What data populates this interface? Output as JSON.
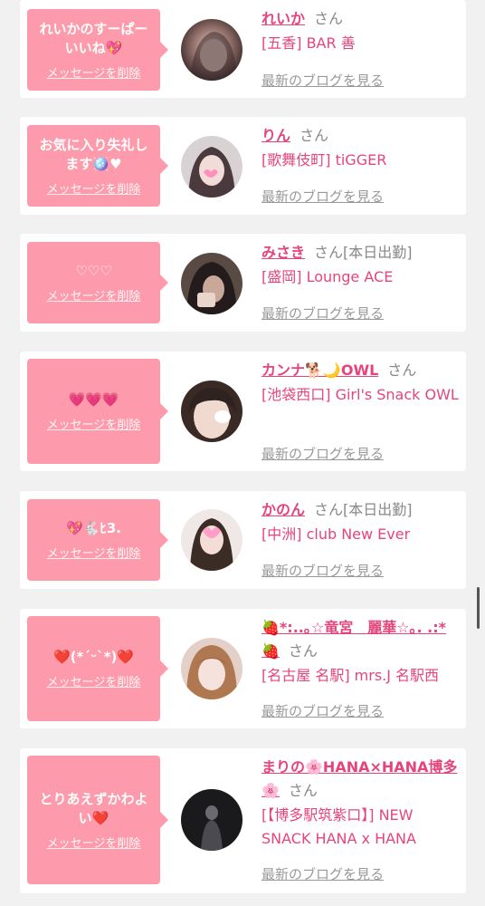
{
  "cards": [
    {
      "message": "れいかのすーぱー\nいいね💖",
      "delete_label": "メッセージを削除",
      "name": "れいか",
      "san": "さん",
      "status": "",
      "shop": "[五香] BAR 善",
      "blog_label": "最新のブログを見る"
    },
    {
      "message": "お気に入り失礼し\nます🪩♥",
      "delete_label": "メッセージを削除",
      "name": "りん",
      "san": "さん",
      "status": "",
      "shop": "[歌舞伎町] tiGGER",
      "blog_label": "最新のブログを見る"
    },
    {
      "message": "♡♡♡",
      "delete_label": "メッセージを削除",
      "name": "みさき",
      "san": "さん",
      "status": "[本日出勤]",
      "shop": "[盛岡] Lounge ACE",
      "blog_label": "最新のブログを見る"
    },
    {
      "message": "💗💗💗",
      "delete_label": "メッセージを削除",
      "name": "カンナ🐕🌙OWL",
      "san": "さん",
      "status": "",
      "shop": "[池袋西口] Girl's Snack OWL",
      "blog_label": "最新のブログを見る"
    },
    {
      "message": "💖🐇ﾋ3.",
      "delete_label": "メッセージを削除",
      "name": "かのん",
      "san": "さん",
      "status": "[本日出勤]",
      "shop": "[中洲] club New Ever",
      "blog_label": "最新のブログを見る"
    },
    {
      "message": "❤️(*´ᵕ`*)❤️",
      "delete_label": "メッセージを削除",
      "name": "🍓*:..｡☆竜宮　麗華☆｡. .:*🍓",
      "san": "さん",
      "status": "",
      "shop": "[名古屋 名駅] mrs.J 名駅西",
      "blog_label": "最新のブログを見る"
    },
    {
      "message": "とりあえずかわよ\nい❤️",
      "delete_label": "メッセージを削除",
      "name": "まりの🌸HANA×HANA博多🌸",
      "san": "さん",
      "status": "",
      "shop": "[【博多駅筑紫口】] NEW SNACK HANA x HANA",
      "blog_label": "最新のブログを見る"
    }
  ],
  "colors": {
    "bubble": "#fd9aab",
    "name": "#e6457a",
    "muted": "#888888",
    "background": "#f1f1f1"
  }
}
